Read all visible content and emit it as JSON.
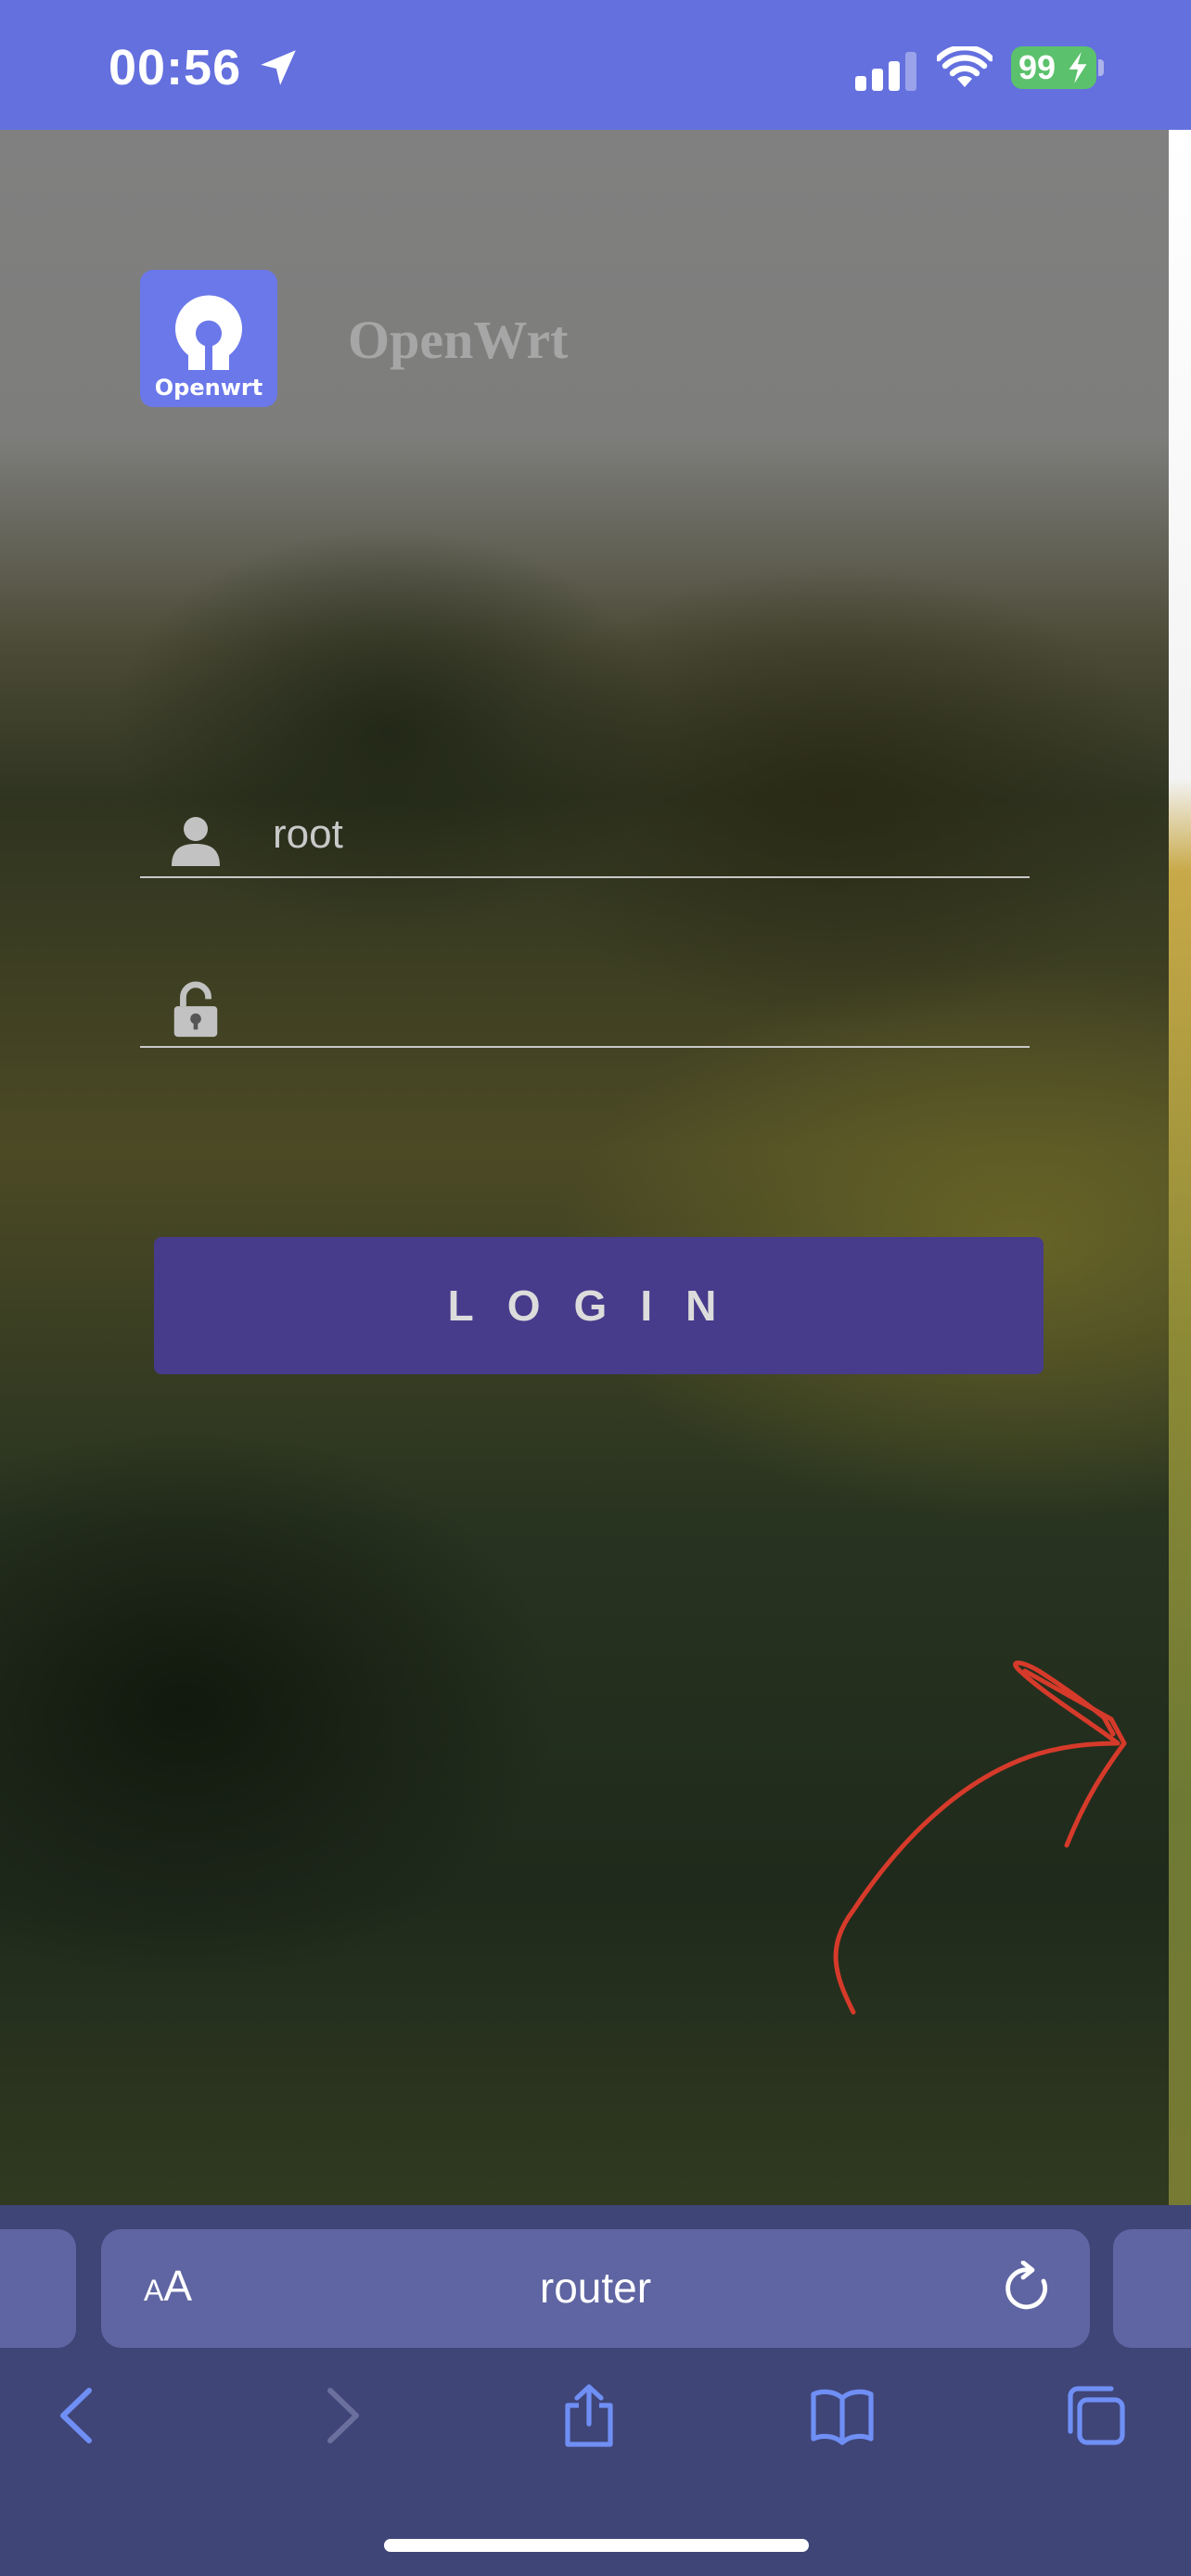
{
  "status_bar": {
    "time": "00:56",
    "battery": "99"
  },
  "page": {
    "logo_text": "Openwrt",
    "brand_name": "OpenWrt",
    "username_value": "root",
    "password_value": "",
    "login_label": "LOGIN"
  },
  "safari": {
    "text_size_label_small": "A",
    "text_size_label_large": "A",
    "url": "router"
  },
  "colors": {
    "status_bar": "#6470de",
    "login_button": "#473b8b",
    "logo_tile": "#6b78ea",
    "annotation": "#d63a2a",
    "battery": "#5bc16c"
  }
}
